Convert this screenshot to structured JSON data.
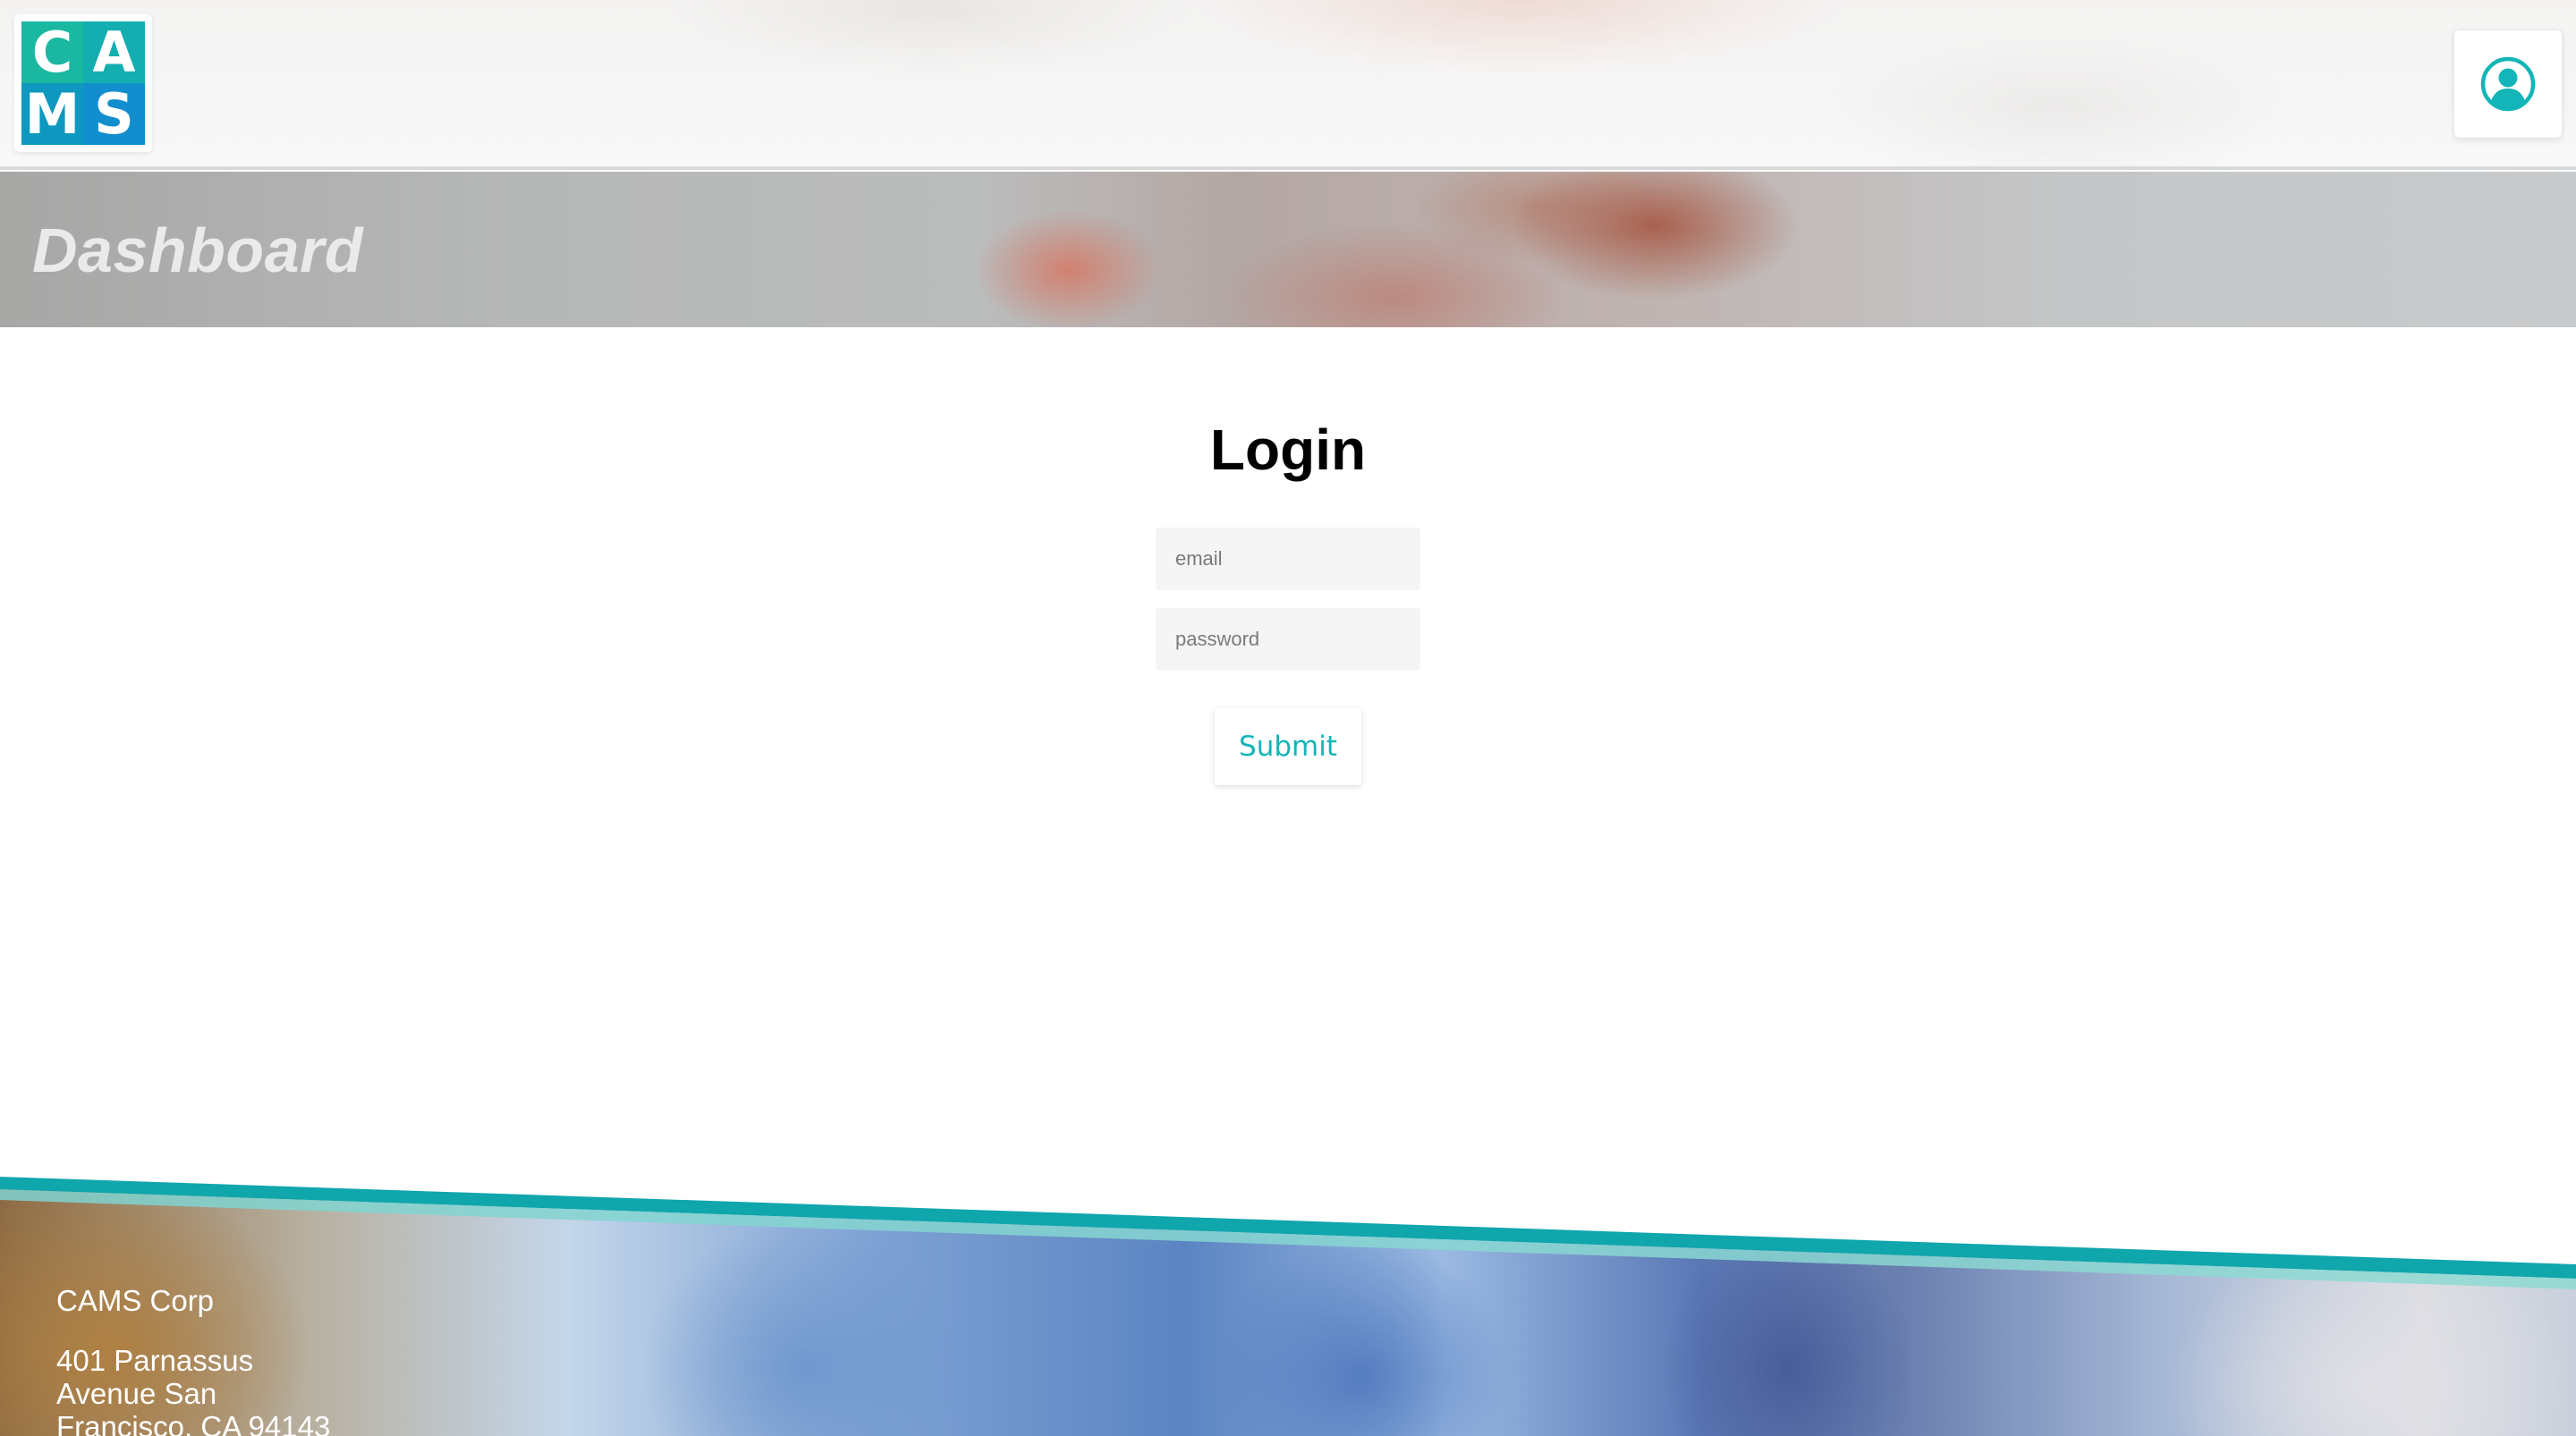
{
  "header": {
    "logo_letters": [
      "C",
      "A",
      "M",
      "S"
    ],
    "user_icon": "user-circle-icon"
  },
  "banner": {
    "title": "Dashboard"
  },
  "login": {
    "title": "Login",
    "email_placeholder": "email",
    "password_placeholder": "password",
    "submit_label": "Submit"
  },
  "footer": {
    "company": "CAMS Corp",
    "address": "401 Parnassus Avenue San Francisco, CA 94143"
  },
  "colors": {
    "accent": "#13b5b8",
    "logo_teal": "#1ab8a1",
    "logo_blue": "#128ecf",
    "footer_stripe": "#0fa6ac"
  }
}
